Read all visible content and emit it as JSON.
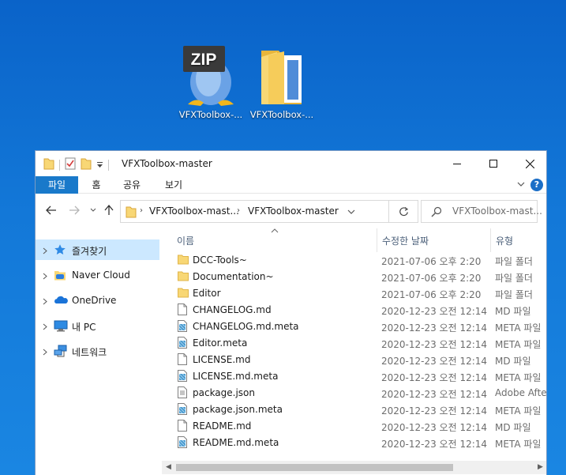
{
  "desktop": {
    "icons": [
      {
        "label": "VFXToolbox-...",
        "badge": "ZIP",
        "kind": "zip-archive"
      },
      {
        "label": "VFXToolbox-...",
        "kind": "folder"
      }
    ]
  },
  "window": {
    "title": "VFXToolbox-master",
    "controls": {
      "minimize": "minimize",
      "maximize": "maximize",
      "close": "close"
    }
  },
  "ribbon": {
    "tabs": [
      "파일",
      "홈",
      "공유",
      "보기"
    ],
    "help": "?"
  },
  "address": {
    "crumbs": [
      "VFXToolbox-mast...",
      "VFXToolbox-master"
    ]
  },
  "search": {
    "placeholder": "VFXToolbox-mast..."
  },
  "nav": {
    "items": [
      {
        "label": "즐겨찾기",
        "icon": "star-icon",
        "selected": true
      },
      {
        "label": "Naver Cloud",
        "icon": "naver-cloud-icon",
        "selected": false
      },
      {
        "label": "OneDrive",
        "icon": "onedrive-icon",
        "selected": false
      },
      {
        "label": "내 PC",
        "icon": "pc-icon",
        "selected": false
      },
      {
        "label": "네트워크",
        "icon": "network-icon",
        "selected": false
      }
    ]
  },
  "list": {
    "columns": {
      "name": "이름",
      "date": "수정한 날짜",
      "type": "유형"
    },
    "rows": [
      {
        "name": "DCC-Tools~",
        "date": "2021-07-06 오후 2:20",
        "type": "파일 폴더",
        "icon": "folder"
      },
      {
        "name": "Documentation~",
        "date": "2021-07-06 오후 2:20",
        "type": "파일 폴더",
        "icon": "folder"
      },
      {
        "name": "Editor",
        "date": "2021-07-06 오후 2:20",
        "type": "파일 폴더",
        "icon": "folder"
      },
      {
        "name": "CHANGELOG.md",
        "date": "2020-12-23 오전 12:14",
        "type": "MD 파일",
        "icon": "doc"
      },
      {
        "name": "CHANGELOG.md.meta",
        "date": "2020-12-23 오전 12:14",
        "type": "META 파일",
        "icon": "meta"
      },
      {
        "name": "Editor.meta",
        "date": "2020-12-23 오전 12:14",
        "type": "META 파일",
        "icon": "meta"
      },
      {
        "name": "LICENSE.md",
        "date": "2020-12-23 오전 12:14",
        "type": "MD 파일",
        "icon": "doc"
      },
      {
        "name": "LICENSE.md.meta",
        "date": "2020-12-23 오전 12:14",
        "type": "META 파일",
        "icon": "meta"
      },
      {
        "name": "package.json",
        "date": "2020-12-23 오전 12:14",
        "type": "Adobe After",
        "icon": "json"
      },
      {
        "name": "package.json.meta",
        "date": "2020-12-23 오전 12:14",
        "type": "META 파일",
        "icon": "meta"
      },
      {
        "name": "README.md",
        "date": "2020-12-23 오전 12:14",
        "type": "MD 파일",
        "icon": "doc"
      },
      {
        "name": "README.md.meta",
        "date": "2020-12-23 오전 12:14",
        "type": "META 파일",
        "icon": "meta"
      }
    ]
  },
  "colors": {
    "accent": "#1979ca",
    "selection": "#cce8ff",
    "folder": "#f8d775"
  }
}
